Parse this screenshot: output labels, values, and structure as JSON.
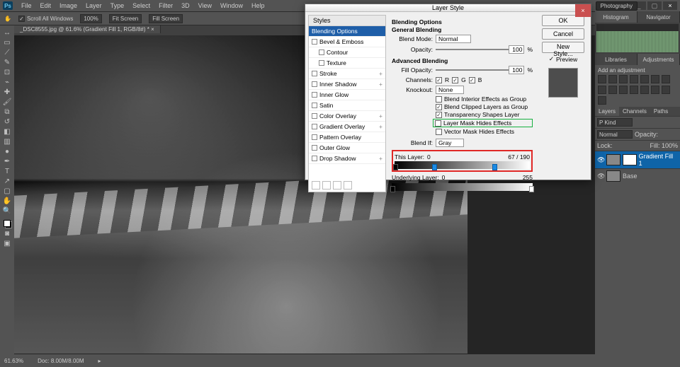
{
  "menu": {
    "items": [
      "File",
      "Edit",
      "Image",
      "Layer",
      "Type",
      "Select",
      "Filter",
      "3D",
      "View",
      "Window",
      "Help"
    ]
  },
  "workspace": "Photography",
  "options": {
    "scrollAll": "Scroll All Windows",
    "pct": "100%",
    "fit": "Fit Screen",
    "fill": "Fill Screen"
  },
  "doc": {
    "tab": "_DSC8555.jpg @ 61.6% (Gradient Fill 1, RGB/8#) *"
  },
  "status": {
    "zoom": "61.63%",
    "docinfo": "Doc: 8.00M/8.00M"
  },
  "rightPanels": {
    "hist": {
      "tabs": [
        "Histogram",
        "Navigator"
      ]
    },
    "adj": {
      "tabs": [
        "Libraries",
        "Adjustments"
      ],
      "label": "Add an adjustment"
    },
    "layers": {
      "tabs": [
        "Layers",
        "Channels",
        "Paths"
      ],
      "kind": "P Kind",
      "blend": "Normal",
      "opacity": "Opacity:",
      "lockLabel": "Lock:",
      "fillLabel": "Fill: 100%",
      "items": [
        {
          "name": "Gradient Fill 1",
          "sel": true
        },
        {
          "name": "Base",
          "sel": false
        }
      ]
    }
  },
  "dialog": {
    "title": "Layer Style",
    "fxlist": {
      "header": "Styles",
      "items": [
        {
          "label": "Blending Options",
          "selected": true,
          "checkbox": false
        },
        {
          "label": "Bevel & Emboss",
          "checkbox": true
        },
        {
          "label": "Contour",
          "checkbox": true,
          "indent": true
        },
        {
          "label": "Texture",
          "checkbox": true,
          "indent": true
        },
        {
          "label": "Stroke",
          "checkbox": true,
          "plus": true
        },
        {
          "label": "Inner Shadow",
          "checkbox": true,
          "plus": true
        },
        {
          "label": "Inner Glow",
          "checkbox": true
        },
        {
          "label": "Satin",
          "checkbox": true
        },
        {
          "label": "Color Overlay",
          "checkbox": true,
          "plus": true
        },
        {
          "label": "Gradient Overlay",
          "checkbox": true,
          "plus": true
        },
        {
          "label": "Pattern Overlay",
          "checkbox": true
        },
        {
          "label": "Outer Glow",
          "checkbox": true
        },
        {
          "label": "Drop Shadow",
          "checkbox": true,
          "plus": true
        }
      ]
    },
    "opts": {
      "section1": "Blending Options",
      "general": "General Blending",
      "blendModeLabel": "Blend Mode:",
      "blendMode": "Normal",
      "opacityLabel": "Opacity:",
      "opacity": "100",
      "pct": "%",
      "section2": "Advanced Blending",
      "fillOpacityLabel": "Fill Opacity:",
      "fillOpacity": "100",
      "channelsLabel": "Channels:",
      "chR": "R",
      "chG": "G",
      "chB": "B",
      "knockoutLabel": "Knockout:",
      "knockout": "None",
      "c1": "Blend Interior Effects as Group",
      "c2": "Blend Clipped Layers as Group",
      "c3": "Transparency Shapes Layer",
      "c4": "Layer Mask Hides Effects",
      "c5": "Vector Mask Hides Effects",
      "blendIfLabel": "Blend If:",
      "blendIf": "Gray",
      "thisLayerLabel": "This Layer:",
      "thisLow": "0",
      "thisHigh1": "67",
      "thisSep": "/",
      "thisHigh2": "190",
      "underLabel": "Underlying Layer:",
      "underLow": "0",
      "underHigh": "255"
    },
    "side": {
      "ok": "OK",
      "cancel": "Cancel",
      "newStyle": "New Style...",
      "preview": "Preview"
    }
  }
}
